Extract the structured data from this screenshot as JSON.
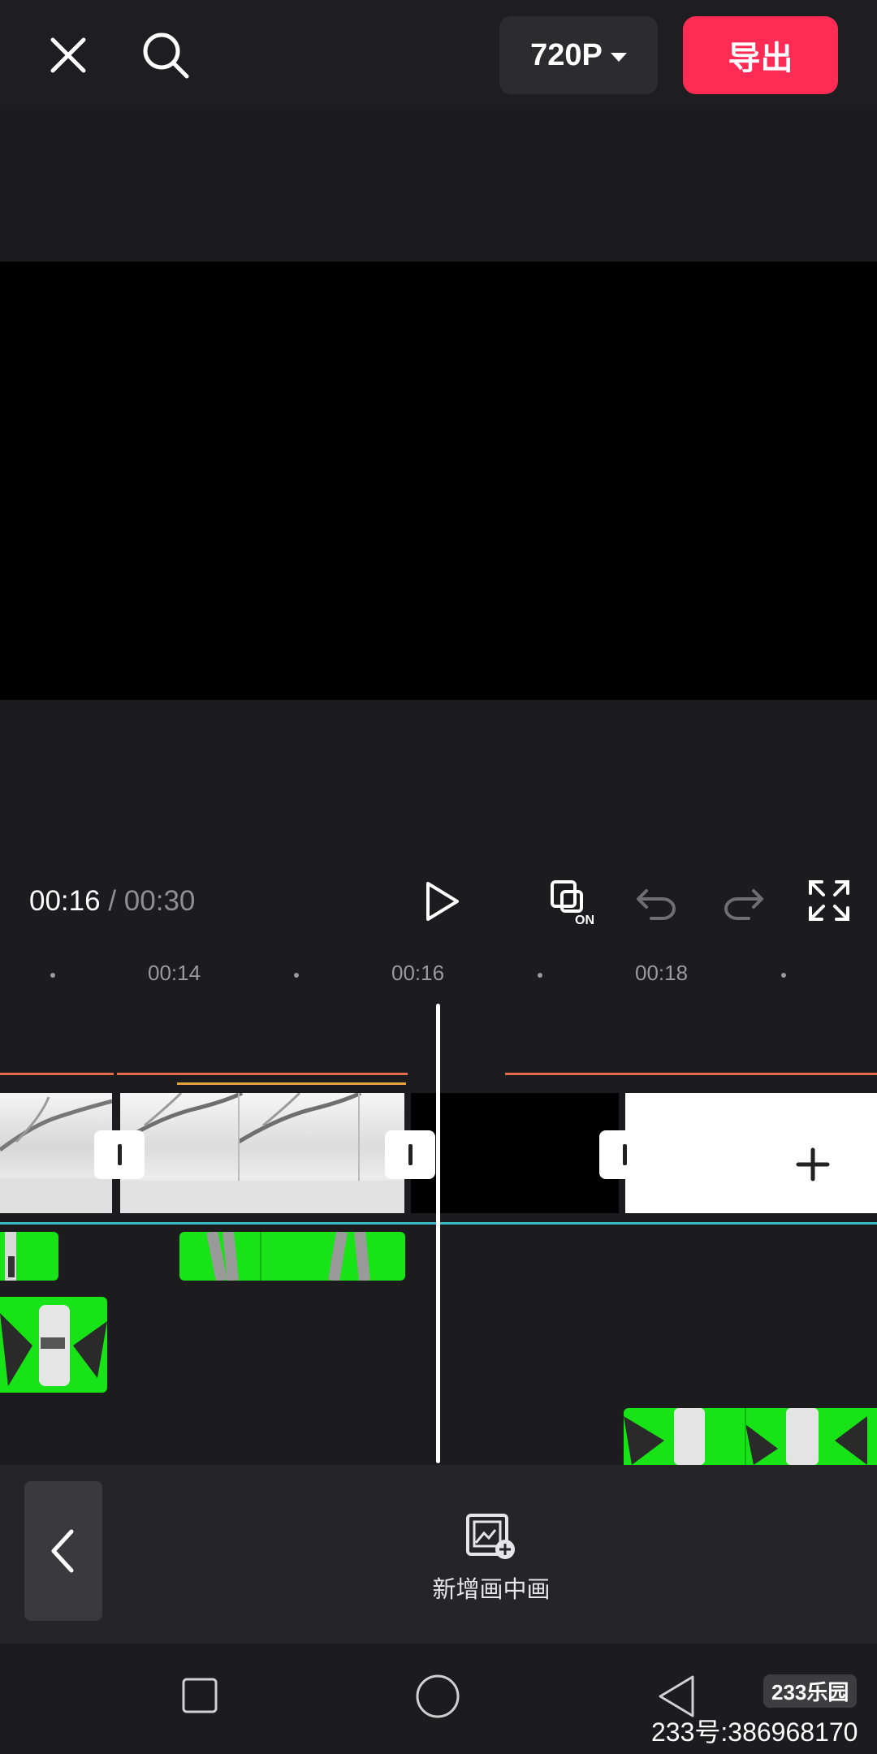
{
  "top_bar": {
    "close_icon": "close-icon",
    "search_icon": "search-icon",
    "resolution_label": "720P",
    "export_label": "导出",
    "accent_color": "#fe2c55"
  },
  "player": {
    "current_time": "00:16",
    "separator": "/",
    "total_time": "00:30",
    "play_icon": "play-icon",
    "keyframe_label": "ON",
    "undo_icon": "undo-icon",
    "redo_icon": "redo-icon",
    "fullscreen_icon": "fullscreen-icon"
  },
  "ruler": {
    "labels": [
      "00:14",
      "00:16",
      "00:18"
    ]
  },
  "bottom_tools": {
    "pip_label": "新增画中画",
    "back_icon": "chevron-left-icon"
  },
  "watermark": {
    "logo": "233乐园",
    "id_text": "233号:386968170"
  }
}
